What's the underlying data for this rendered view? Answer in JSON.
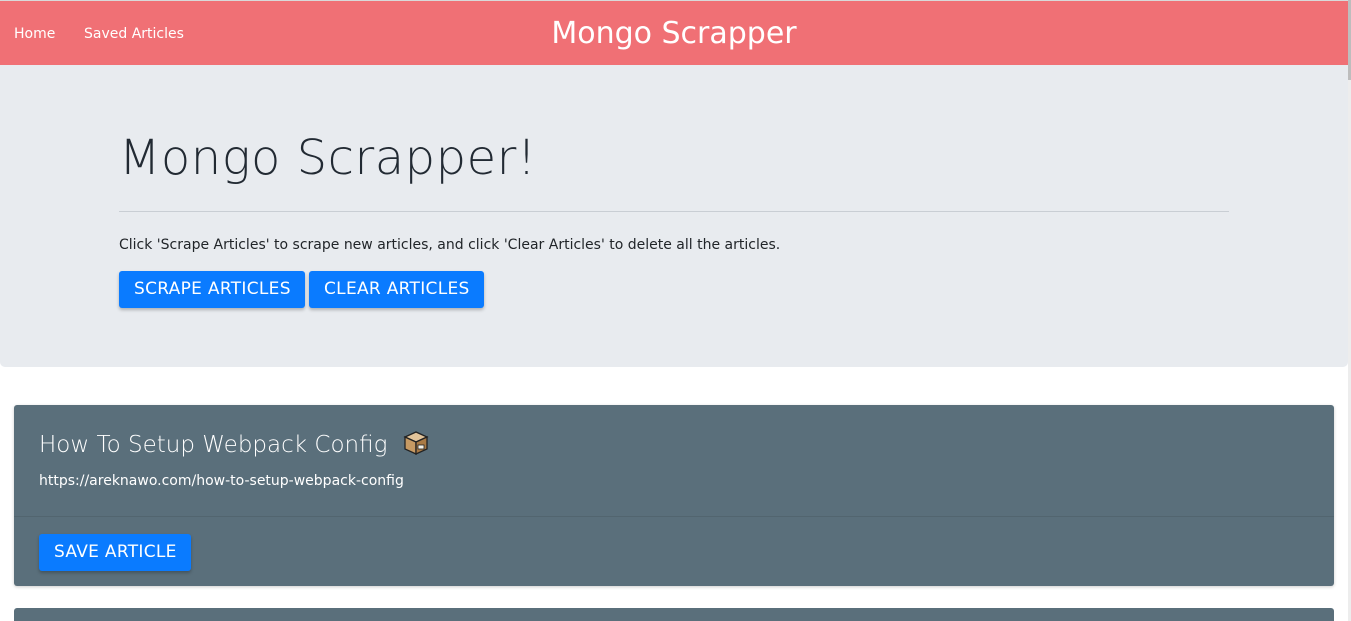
{
  "navbar": {
    "links": [
      {
        "label": "Home"
      },
      {
        "label": "Saved Articles"
      }
    ],
    "brand": "Mongo Scrapper"
  },
  "jumbotron": {
    "title": "Mongo Scrapper!",
    "description": "Click 'Scrape Articles' to scrape new articles, and click 'Clear Articles' to delete all the articles.",
    "scrape_label": "SCRAPE ARTICLES",
    "clear_label": "CLEAR ARTICLES"
  },
  "articles": [
    {
      "title": "How To Setup Webpack Config",
      "icon": "package-icon",
      "url": "https://areknawo.com/how-to-setup-webpack-config",
      "save_label": "SAVE ARTICLE"
    }
  ],
  "colors": {
    "navbar": "#f07075",
    "jumbotron": "#e8ebef",
    "card": "#5a6f7b",
    "button": "#0a7bff"
  }
}
